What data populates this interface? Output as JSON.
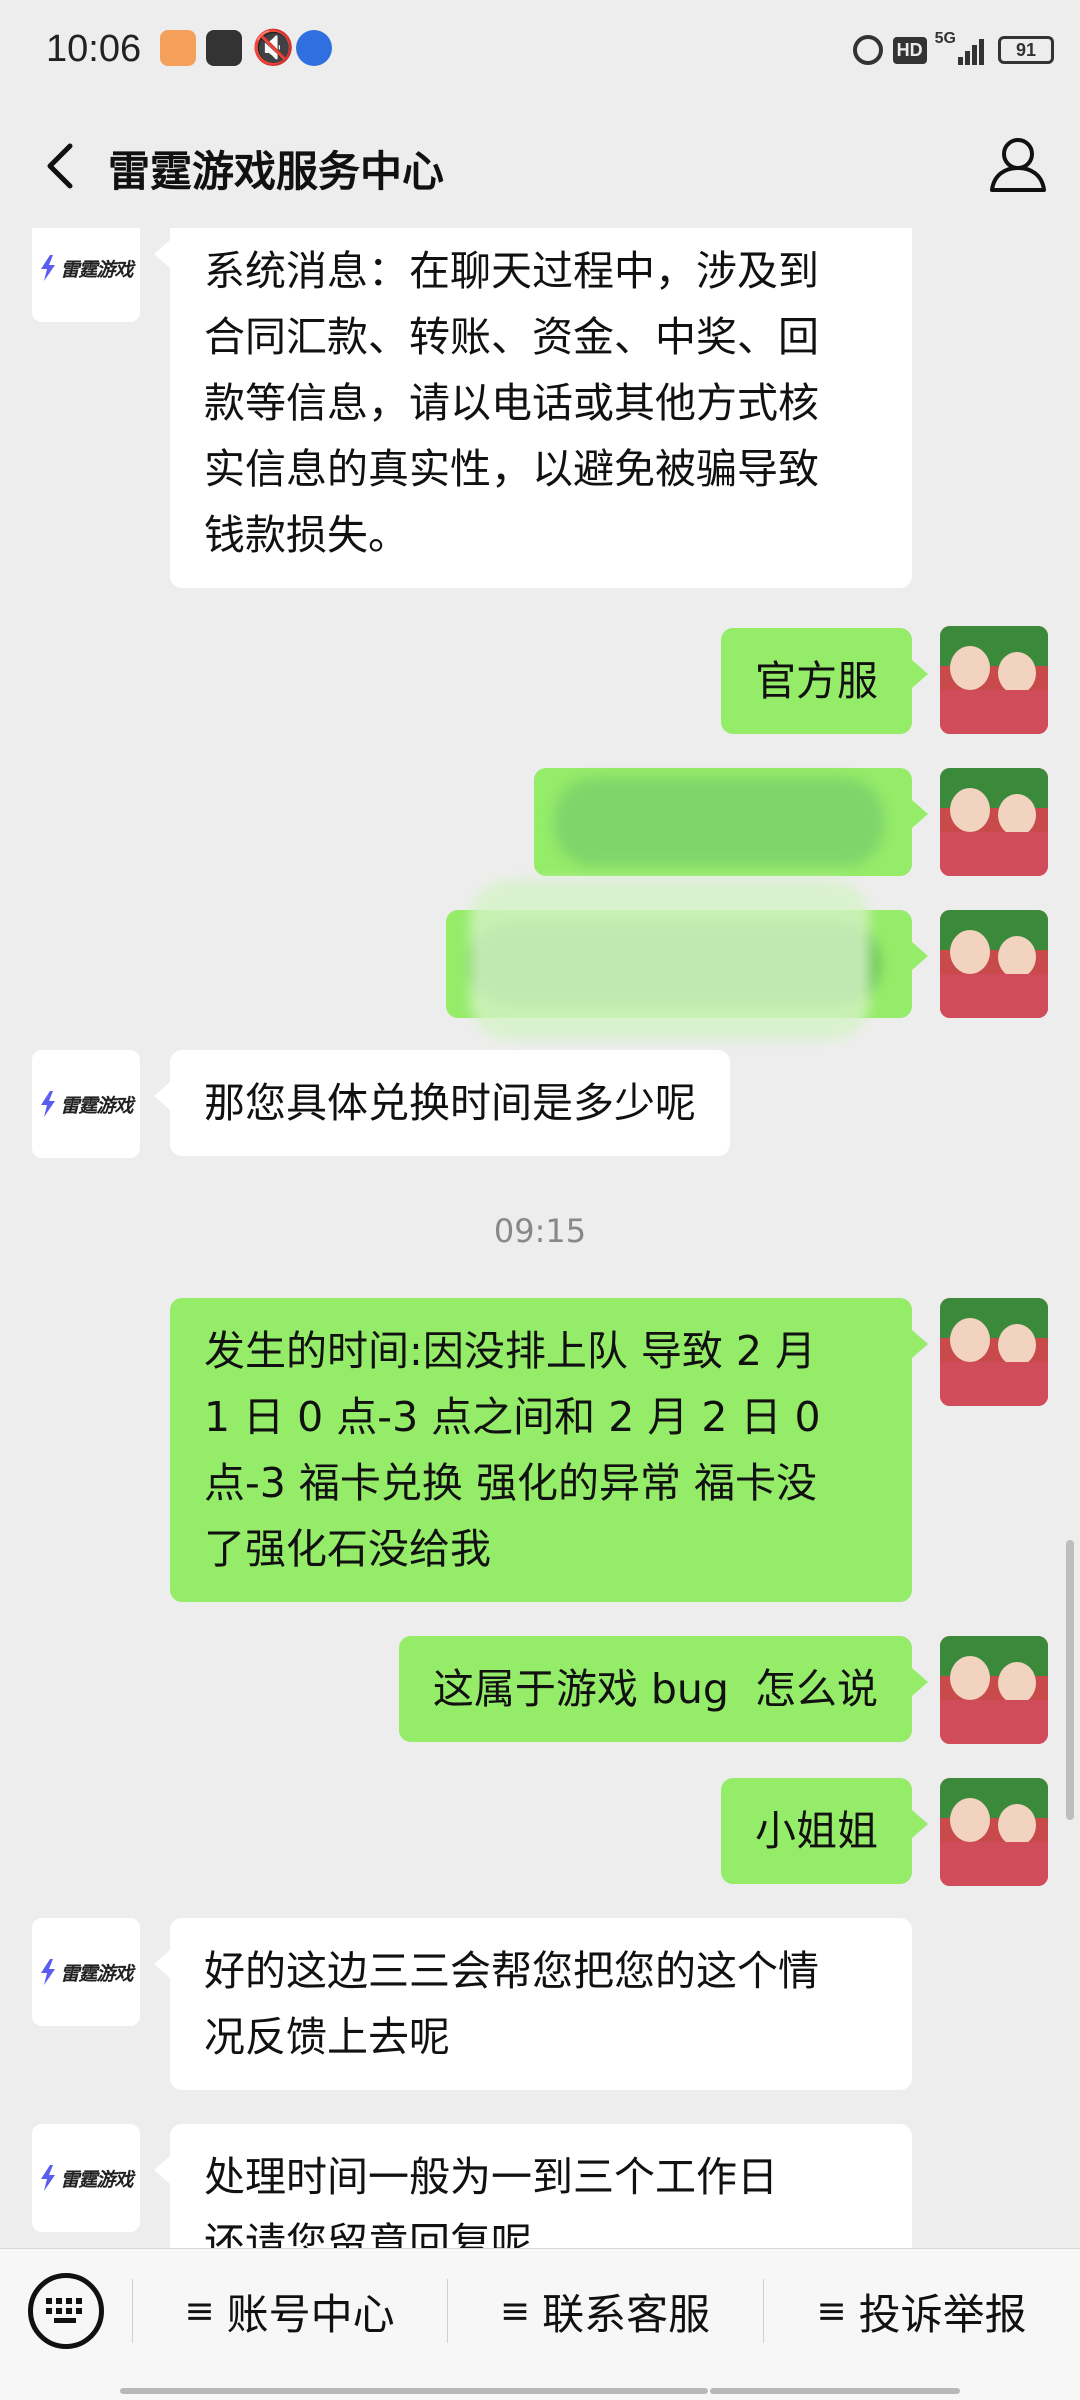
{
  "status_bar": {
    "time": "10:06",
    "network": "5G",
    "hd": "HD",
    "battery": "91"
  },
  "header": {
    "title": "雷霆游戏服务中心"
  },
  "official_logo_text": "雷霆游戏",
  "messages": [
    {
      "from": "official",
      "lines": [
        "系统消息：在聊天过程中，涉及到",
        "合同汇款、转账、资金、中奖、回",
        "款等信息，请以电话或其他方式核",
        "实信息的真实性，以避免被骗导致",
        "钱款损失。"
      ]
    },
    {
      "from": "user",
      "lines": [
        "官方服"
      ]
    },
    {
      "from": "user",
      "lines": [],
      "redacted": true
    },
    {
      "from": "user",
      "lines": [],
      "redacted": true
    },
    {
      "from": "official",
      "lines": [
        "那您具体兑换时间是多少呢"
      ]
    },
    {
      "from": "user",
      "lines": [
        "发生的时间:因没排上队  导致 2 月",
        "1 日 0 点-3 点之间和 2 月 2 日 0",
        "点-3 福卡兑换 强化的异常 福卡没",
        "了强化石没给我"
      ]
    },
    {
      "from": "user",
      "lines": [
        "这属于游戏 bug  怎么说"
      ]
    },
    {
      "from": "user",
      "lines": [
        "小姐姐"
      ]
    },
    {
      "from": "official",
      "lines": [
        "好的这边三三会帮您把您的这个情",
        "况反馈上去呢"
      ]
    },
    {
      "from": "official",
      "lines": [
        "处理时间一般为一到三个工作日",
        "还请您留意回复呢"
      ]
    }
  ],
  "timestamp": "09:15",
  "bottom_menu": {
    "items": [
      "账号中心",
      "联系客服",
      "投诉举报"
    ]
  },
  "colors": {
    "user_bubble": "#95ec69",
    "official_bubble": "#ffffff",
    "background": "#ededed"
  }
}
